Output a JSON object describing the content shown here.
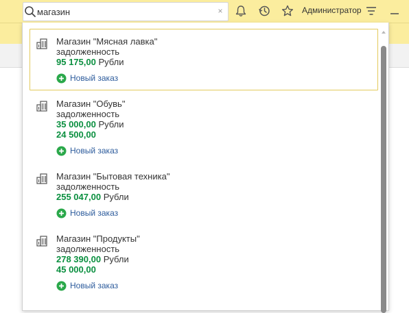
{
  "search": {
    "value": "магазин",
    "clear_label": "×"
  },
  "header": {
    "user": "Администратор"
  },
  "icons": {
    "search": "magnifier-icon",
    "bell": "bell-icon",
    "history": "history-icon",
    "favorites": "star-icon",
    "menu": "menu-icon",
    "minimize": "minimize-icon",
    "building": "building-icon",
    "add": "plus-circle-icon"
  },
  "colors": {
    "header_bg": "#fbed9e",
    "amount": "#0a8f3f",
    "link": "#2b5a9b",
    "selected_border": "#e3c95a"
  },
  "results": [
    {
      "title": "Магазин \"Мясная лавка\"",
      "debt_label": "задолженность",
      "amount": "95 175,00",
      "currency": "Рубли",
      "action": "Новый заказ"
    },
    {
      "title": "Магазин \"Обувь\"",
      "debt_label": "задолженность",
      "amount": "35 000,00",
      "currency": "Рубли",
      "amount2": "24 500,00",
      "action": "Новый заказ"
    },
    {
      "title": "Магазин \"Бытовая техника\"",
      "debt_label": "задолженность",
      "amount": "255 047,00",
      "currency": "Рубли",
      "action": "Новый заказ"
    },
    {
      "title": "Магазин \"Продукты\"",
      "debt_label": "задолженность",
      "amount": "278 390,00",
      "currency": "Рубли",
      "amount2": "45 000,00",
      "action": "Новый заказ"
    }
  ]
}
